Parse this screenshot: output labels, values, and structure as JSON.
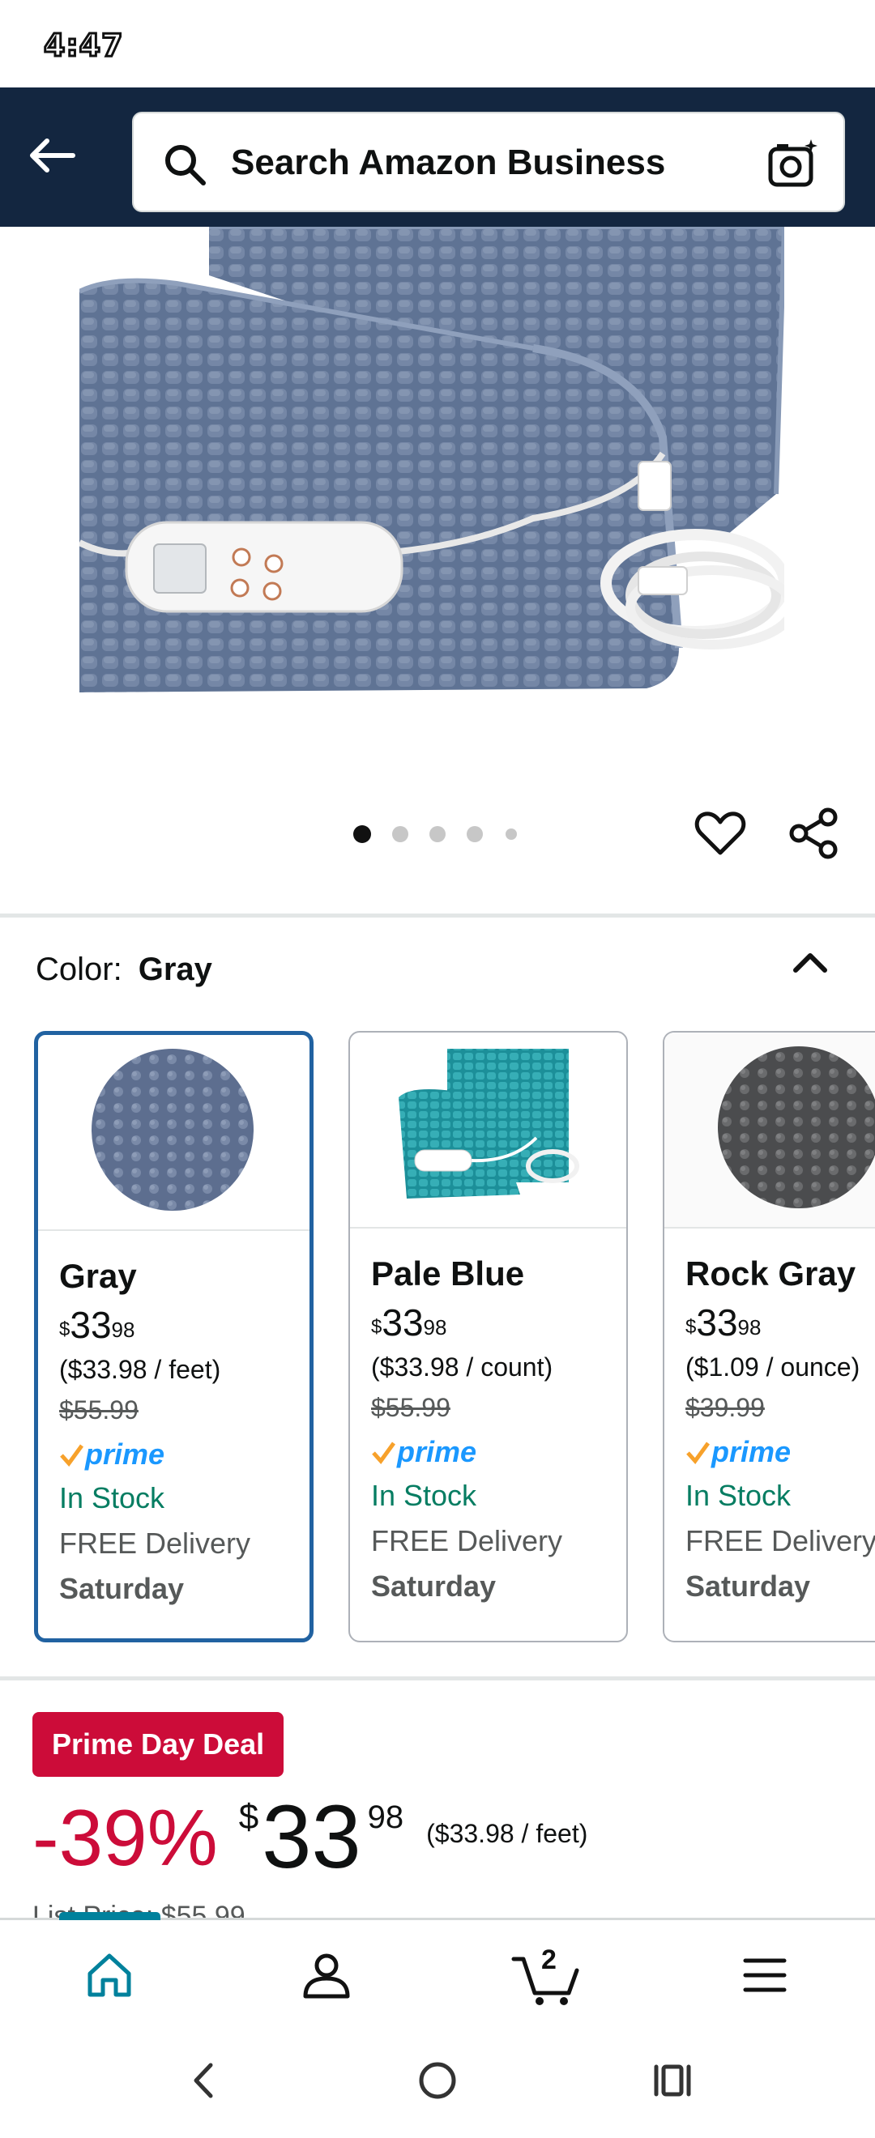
{
  "status_bar": {
    "time": "4:47"
  },
  "header": {
    "search_placeholder": "Search Amazon Business",
    "colors": {
      "background": "#132640"
    }
  },
  "product": {
    "image_alt": "Gray heating pad with controller",
    "carousel": {
      "count": 5,
      "active_index": 0
    }
  },
  "color_selector": {
    "label": "Color:",
    "selected": "Gray",
    "options": [
      {
        "name": "Gray",
        "currency": "$",
        "whole": "33",
        "cents": "98",
        "unit_price": "($33.98 / feet)",
        "list_price": "$55.99",
        "prime": "prime",
        "stock": "In Stock",
        "delivery": "FREE Delivery",
        "day": "Saturday"
      },
      {
        "name": "Pale Blue",
        "currency": "$",
        "whole": "33",
        "cents": "98",
        "unit_price": "($33.98 / count)",
        "list_price": "$55.99",
        "prime": "prime",
        "stock": "In Stock",
        "delivery": "FREE Delivery",
        "day": "Saturday"
      },
      {
        "name": "Rock Gray",
        "currency": "$",
        "whole": "33",
        "cents": "98",
        "unit_price": "($1.09 / ounce)",
        "list_price": "$39.99",
        "prime": "prime",
        "stock": "In Stock",
        "delivery": "FREE Delivery",
        "day": "Saturday"
      }
    ]
  },
  "deal": {
    "badge": "Prime Day Deal",
    "discount": "-39%",
    "currency": "$",
    "whole": "33",
    "cents": "98",
    "unit_price": "($33.98 / feet)",
    "list_price_label": "List Price: $55.99"
  },
  "tabbar": {
    "cart_count": "2",
    "accent": "#00819c"
  },
  "colors": {
    "prime_blue": "#1a98ff",
    "prime_check": "#f7a12b",
    "deal_red": "#cc0c39",
    "stock_green": "#067d62"
  }
}
